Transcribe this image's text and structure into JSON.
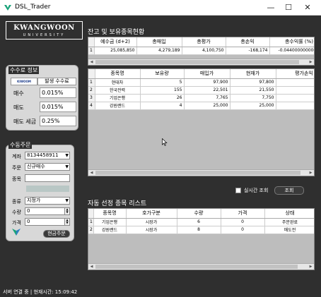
{
  "window": {
    "title": "DSL_Trader",
    "minimize": "—",
    "maximize": "☐",
    "close": "✕",
    "icon_color": "#1aa37a"
  },
  "logo": {
    "main": "KWANGWOON",
    "sub": "UNIVERSITY"
  },
  "fee_panel": {
    "title": "수수료 정보",
    "brand": "KIWOOM",
    "header": "발생 수수료",
    "rows": [
      {
        "label": "매수",
        "value": "0.015%"
      },
      {
        "label": "매도",
        "value": "0.015%"
      },
      {
        "label": "매도 세금",
        "value": "0.25%"
      }
    ]
  },
  "order_panel": {
    "title": "수동주문",
    "account_label": "계좌",
    "account_value": "8134458911",
    "order_label": "주문",
    "order_value": "신규매수",
    "item_label": "종목",
    "item_value": "",
    "type_label": "종류",
    "type_value": "지정가",
    "qty_label": "수량",
    "qty_value": "0",
    "price_label": "가격",
    "price_value": "0",
    "cash_order_button": "현금주문"
  },
  "holdings": {
    "title": "잔고 및 보유종목현황",
    "summary": {
      "columns": [
        "예수금 (d+2)",
        "총매입",
        "총평가",
        "총손익",
        "총수익률 (%)"
      ],
      "row": [
        "25,085,850",
        "4,279,189",
        "4,100,750",
        "-168,174",
        "-0.0440000000000000"
      ]
    },
    "stocks": {
      "columns": [
        "종목명",
        "보유량",
        "매입가",
        "현재가",
        "평가손익"
      ],
      "rows": [
        {
          "idx": "1",
          "name": "현대차",
          "qty": "5",
          "buy": "97,900",
          "cur": "97,800",
          "pl": ""
        },
        {
          "idx": "2",
          "name": "한국전력",
          "qty": "155",
          "buy": "22,501",
          "cur": "21,550",
          "pl": "-1"
        },
        {
          "idx": "3",
          "name": "기업은행",
          "qty": "26",
          "buy": "7,765",
          "cur": "7,750",
          "pl": ""
        },
        {
          "idx": "4",
          "name": "강원랜드",
          "qty": "4",
          "buy": "25,000",
          "cur": "25,000",
          "pl": ""
        }
      ]
    },
    "realtime_label": "실시간 조회",
    "query_button": "조회"
  },
  "auto_list": {
    "title": "자동 선정 종목 리스트",
    "columns": [
      "종목명",
      "호가구분",
      "수량",
      "가격",
      "상태"
    ],
    "rows": [
      {
        "idx": "1",
        "name": "기업은행",
        "type": "시장가",
        "qty": "6",
        "price": "0",
        "status": "주문완료"
      },
      {
        "idx": "2",
        "name": "강원랜드",
        "type": "시장가",
        "qty": "8",
        "price": "0",
        "status": "매도전"
      }
    ]
  },
  "status_bar": "서버 연결 중 | 현재시간: 15:09:42"
}
